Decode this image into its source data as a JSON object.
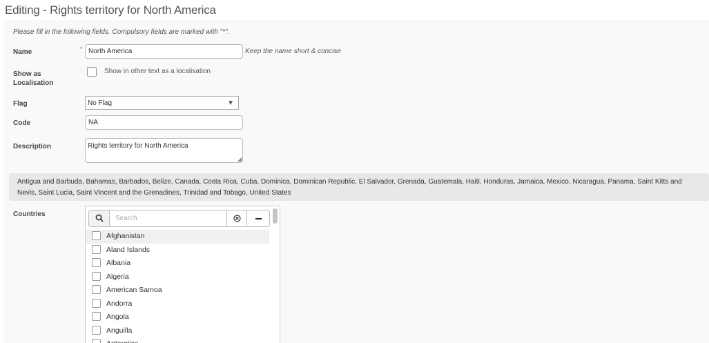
{
  "page": {
    "title": "Editing - Rights territory for North America",
    "instructions": "Please fill in the following fields. Compulsory fields are marked with \"*\"."
  },
  "form": {
    "name": {
      "label": "Name",
      "required_marker": "*",
      "value": "North America",
      "hint": "Keep the name short & concise"
    },
    "localisation": {
      "label": "Show as Localisation",
      "checkbox_label": "Show in other text as a localisation",
      "checked": false
    },
    "flag": {
      "label": "Flag",
      "selected": "No Flag"
    },
    "code": {
      "label": "Code",
      "value": "NA"
    },
    "description": {
      "label": "Description",
      "value": "Rights territory for North America"
    },
    "countries": {
      "label": "Countries",
      "selected_summary": "Antigua and Barbuda, Bahamas, Barbados, Belize, Canada, Costa Rica, Cuba, Dominica, Dominican Republic, El Salvador, Grenada, Guatemala, Haiti, Honduras, Jamaica, Mexico, Nicaragua, Panama, Saint Kitts and Nevis, Saint Lucia, Saint Vincent and the Grenadines, Trinidad and Tobago, United States",
      "search_placeholder": "Search",
      "items": [
        "Afghanistan",
        "Aland Islands",
        "Albania",
        "Algeria",
        "American Samoa",
        "Andorra",
        "Angola",
        "Anguilla",
        "Antarctica"
      ]
    }
  },
  "icons": {
    "search": "search-icon",
    "clear": "clear-circle-icon",
    "collapse": "minus-icon",
    "dropdown": "caret-down-icon"
  }
}
